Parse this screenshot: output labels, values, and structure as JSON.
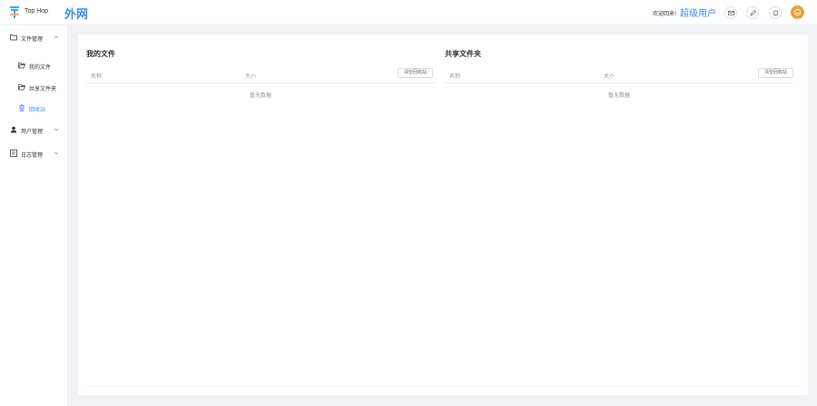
{
  "header": {
    "brand": "Top Hop",
    "title": "外网",
    "welcome": "欢迎回来!",
    "username": "超级用户"
  },
  "sidebar": {
    "items": [
      {
        "label": "文件管理",
        "icon": "folder-icon",
        "expanded": true
      },
      {
        "label": "我的文件",
        "icon": "folder-open-icon"
      },
      {
        "label": "共享文件夹",
        "icon": "folder-open-icon"
      },
      {
        "label": "回收站",
        "icon": "trash-icon",
        "active": true
      },
      {
        "label": "用户管理",
        "icon": "user-icon"
      },
      {
        "label": "日志管理",
        "icon": "log-icon"
      }
    ]
  },
  "panels": {
    "my_files": {
      "title": "我的文件",
      "col_name": "名称",
      "col_size": "大小",
      "clear_btn": "清空回收站",
      "empty": "暂无数据"
    },
    "shared": {
      "title": "共享文件夹",
      "col_name": "名称",
      "col_size": "大小",
      "clear_btn": "清空回收站",
      "empty": "暂无数据"
    }
  },
  "colors": {
    "accent": "#3a8ee6",
    "avatar": "#e6a23c",
    "logo": "#409eff"
  }
}
